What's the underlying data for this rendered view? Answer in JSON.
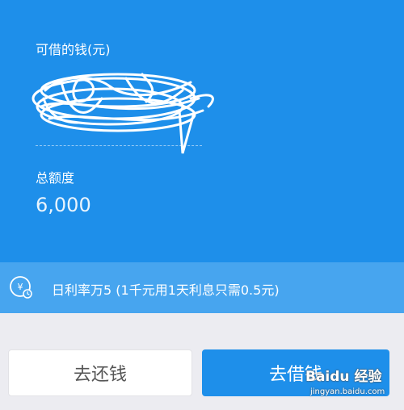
{
  "header": {
    "available_label": "可借的钱(元)",
    "total_label": "总额度",
    "total_value": "6,000"
  },
  "rate_bar": {
    "icon": "yen-clock-icon",
    "text": "日利率万5 (1千元用1天利息只需0.5元)"
  },
  "actions": {
    "repay_label": "去还钱",
    "borrow_label": "去借钱"
  },
  "watermark": {
    "logo_text": "Baidu 经验",
    "url_text": "jingyan.baidu.com"
  },
  "colors": {
    "primary_blue": "#1e8fea",
    "rate_bar_blue": "#47a5ef",
    "page_background": "#ececf1"
  }
}
